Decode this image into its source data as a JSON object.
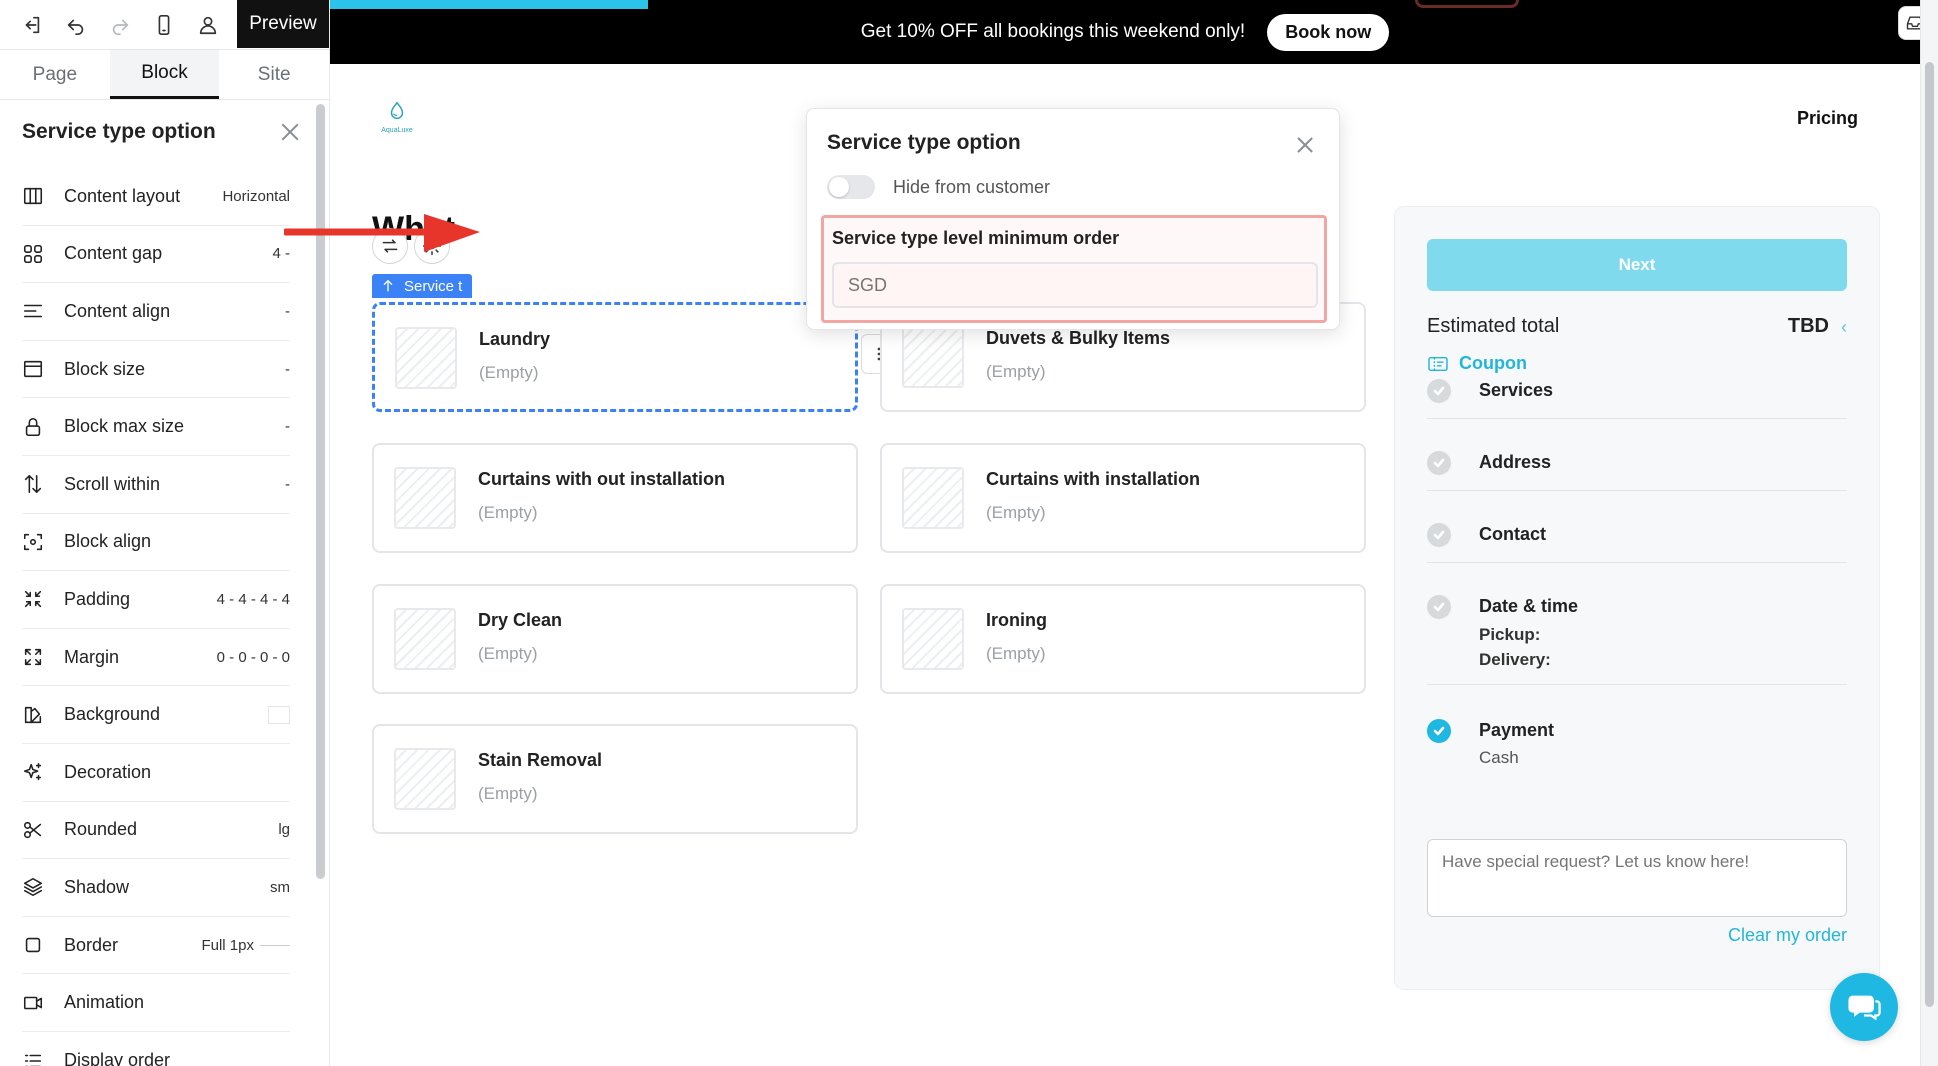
{
  "toolbar": {
    "icons": [
      "exit-icon",
      "undo-icon",
      "redo-icon",
      "mobile-icon",
      "user-icon"
    ],
    "preview_label": "Preview"
  },
  "tabs": [
    "Page",
    "Block",
    "Site"
  ],
  "active_tab": "Block",
  "panel": {
    "title": "Service type option",
    "properties": [
      {
        "label": "Content layout",
        "value": "Horizontal",
        "icon": "columns-icon"
      },
      {
        "label": "Content gap",
        "value": "4 -",
        "icon": "grid-icon"
      },
      {
        "label": "Content align",
        "value": "-",
        "icon": "align-icon"
      },
      {
        "label": "Block size",
        "value": "-",
        "icon": "window-icon"
      },
      {
        "label": "Block max size",
        "value": "-",
        "icon": "lock-icon"
      },
      {
        "label": "Scroll within",
        "value": "-",
        "icon": "scroll-icon"
      },
      {
        "label": "Block align",
        "value": "",
        "icon": "target-icon"
      },
      {
        "label": "Padding",
        "value": "4 - 4 - 4 - 4",
        "icon": "collapse-icon"
      },
      {
        "label": "Margin",
        "value": "0 - 0 - 0 - 0",
        "icon": "expand-icon"
      },
      {
        "label": "Background",
        "value": "",
        "icon": "palette-icon"
      },
      {
        "label": "Decoration",
        "value": "",
        "icon": "sparkle-icon"
      },
      {
        "label": "Rounded",
        "value": "lg",
        "icon": "scissors-icon"
      },
      {
        "label": "Shadow",
        "value": "sm",
        "icon": "layers-icon"
      },
      {
        "label": "Border",
        "value": "Full 1px",
        "icon": "square-icon"
      },
      {
        "label": "Animation",
        "value": "",
        "icon": "video-icon"
      },
      {
        "label": "Display order",
        "value": "",
        "icon": "list-icon"
      }
    ]
  },
  "announcement": {
    "text": "Get 10% OFF all bookings this weekend only!",
    "cta": "Book now"
  },
  "site": {
    "logo_text": "AquaLuxe",
    "nav_pricing": "Pricing",
    "heading": "What"
  },
  "block_tag": "Service t",
  "services": [
    {
      "title": "Laundry",
      "sub": "(Empty)"
    },
    {
      "title": "Duvets & Bulky Items",
      "sub": "(Empty)"
    },
    {
      "title": "Curtains with out installation",
      "sub": "(Empty)"
    },
    {
      "title": "Curtains with installation",
      "sub": "(Empty)"
    },
    {
      "title": "Dry Clean",
      "sub": "(Empty)"
    },
    {
      "title": "Ironing",
      "sub": "(Empty)"
    },
    {
      "title": "Stain Removal",
      "sub": "(Empty)"
    }
  ],
  "summary": {
    "next": "Next",
    "estimated_label": "Estimated total",
    "estimated_value": "TBD",
    "coupon": "Coupon",
    "steps": {
      "services": "Services",
      "address": "Address",
      "contact": "Contact",
      "datetime": "Date & time",
      "pickup": "Pickup:",
      "delivery": "Delivery:",
      "payment": "Payment",
      "payment_method": "Cash"
    },
    "special_request_placeholder": "Have special request? Let us know here!",
    "clear": "Clear my order"
  },
  "popover": {
    "title": "Service type option",
    "toggle_label": "Hide from customer",
    "toggle_on": false,
    "field_label": "Service type level minimum order",
    "field_placeholder": "SGD"
  },
  "colors": {
    "accent": "#1fb8e3",
    "selection": "#3b82f6",
    "annotation": "#e8352b"
  }
}
